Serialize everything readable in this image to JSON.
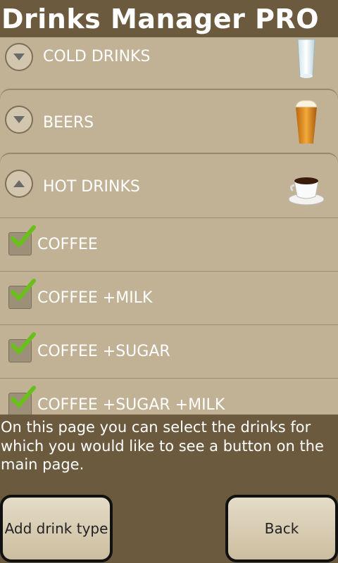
{
  "app": {
    "title": "Drinks Manager PRO"
  },
  "groups": [
    {
      "label": "COLD DRINKS",
      "expanded": false,
      "icon": "water-glass-icon"
    },
    {
      "label": "BEERS",
      "expanded": false,
      "icon": "beer-glass-icon"
    },
    {
      "label": "HOT DRINKS",
      "expanded": true,
      "icon": "coffee-cup-icon"
    }
  ],
  "hot_drinks": [
    {
      "label": "COFFEE",
      "checked": true
    },
    {
      "label": "COFFEE +MILK",
      "checked": true
    },
    {
      "label": "COFFEE +SUGAR",
      "checked": true
    },
    {
      "label": "COFFEE +SUGAR +MILK",
      "checked": true
    }
  ],
  "description": "On this page you can select the drinks for which you would like to see a button on the main page.",
  "buttons": {
    "add": "Add drink type",
    "back": "Back"
  },
  "colors": {
    "background": "#6b5a3e",
    "list": "#c1b296",
    "check": "#6abf1a"
  }
}
